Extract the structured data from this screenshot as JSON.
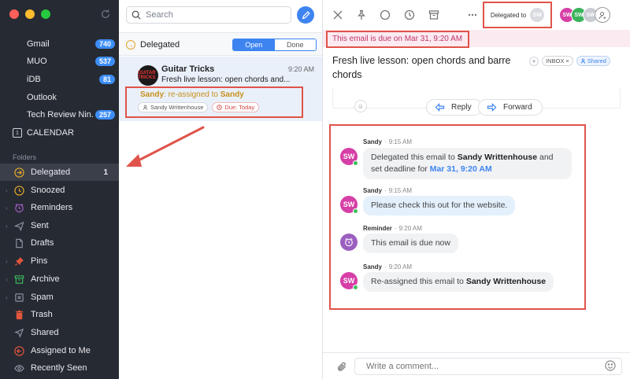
{
  "sidebar": {
    "accounts": [
      {
        "label": "Gmail",
        "count": "740"
      },
      {
        "label": "MUO",
        "count": "537"
      },
      {
        "label": "iDB",
        "count": "81"
      },
      {
        "label": "Outlook",
        "count": ""
      },
      {
        "label": "Tech Review Nin...",
        "count": "257"
      }
    ],
    "calendar": {
      "label": "CALENDAR",
      "icon_text": "1"
    },
    "folders_header": "Folders",
    "folders": [
      {
        "label": "Delegated",
        "count": "1",
        "icon": "delegated-icon",
        "color": "#e0a52a"
      },
      {
        "label": "Snoozed",
        "count": "",
        "icon": "snooze-icon",
        "color": "#e0a52a"
      },
      {
        "label": "Reminders",
        "count": "",
        "icon": "alarm-icon",
        "color": "#a25ec9"
      },
      {
        "label": "Sent",
        "count": "",
        "icon": "send-icon",
        "color": "#8b90a0"
      },
      {
        "label": "Drafts",
        "count": "",
        "icon": "draft-icon",
        "color": "#8b90a0"
      },
      {
        "label": "Pins",
        "count": "",
        "icon": "pin-icon",
        "color": "#e2563c"
      },
      {
        "label": "Archive",
        "count": "",
        "icon": "archive-icon",
        "color": "#3bb35a"
      },
      {
        "label": "Spam",
        "count": "",
        "icon": "spam-icon",
        "color": "#8b90a0"
      },
      {
        "label": "Trash",
        "count": "",
        "icon": "trash-icon",
        "color": "#e2563c"
      },
      {
        "label": "Shared",
        "count": "",
        "icon": "shared-icon",
        "color": "#8b90a0"
      },
      {
        "label": "Assigned to Me",
        "count": "",
        "icon": "assigned-icon",
        "color": "#e2563c"
      },
      {
        "label": "Recently Seen",
        "count": "",
        "icon": "eye-icon",
        "color": "#8b90a0"
      }
    ]
  },
  "list": {
    "search_placeholder": "Search",
    "header_title": "Delegated",
    "seg_open": "Open",
    "seg_done": "Done",
    "message": {
      "sender": "Guitar Tricks",
      "avatar_text": "GUITAR TRICKS",
      "time": "9:20 AM",
      "subject": "Fresh live lesson: open chords and...",
      "reassigned_name": "Sandy",
      "reassigned_mid": ": re-assigned to ",
      "reassigned_target": "Sandy",
      "chip_user": "Sandy Writtenhouse",
      "chip_due": "Due: Today"
    }
  },
  "detail": {
    "delegated_to_label": "Delegated to",
    "delegated_avatar": "SW",
    "avatars": [
      {
        "initials": "SW",
        "color": "#d63fa6"
      },
      {
        "initials": "SW",
        "color": "#3bb35a"
      },
      {
        "initials": "SW",
        "color": "#c9ccd3"
      }
    ],
    "due_banner": "This email is due on Mar 31, 9:20 AM",
    "subject": "Fresh live lesson: open chords and barre chords",
    "tag_inbox": "INBOX",
    "tag_shared": "Shared",
    "reply_label": "Reply",
    "forward_label": "Forward",
    "comments": [
      {
        "author": "Sandy",
        "time": "9:15 AM",
        "avatar": "SW",
        "text_a": "Delegated this email to ",
        "text_b": "Sandy Writtenhouse",
        "text_c": " and set deadline for ",
        "text_d": "Mar 31, 9:20 AM"
      },
      {
        "author": "Sandy",
        "time": "9:15 AM",
        "avatar": "SW",
        "text": "Please check this out for the website."
      },
      {
        "author": "Reminder",
        "time": "9:20 AM",
        "text": "This email is due now"
      },
      {
        "author": "Sandy",
        "time": "9:20 AM",
        "avatar": "SW",
        "text_a": "Re-assigned this email to ",
        "text_b": "Sandy Writtenhouse"
      }
    ],
    "comment_placeholder": "Write a comment..."
  }
}
